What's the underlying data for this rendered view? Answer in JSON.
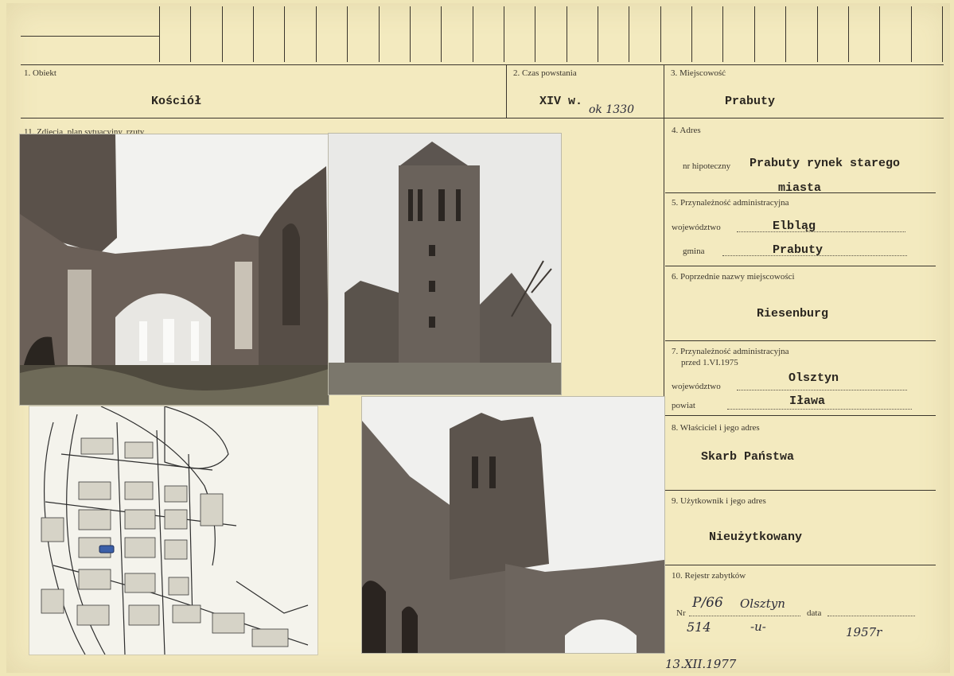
{
  "header": {
    "object_label": "1. Obiekt",
    "object_value": "Kościół",
    "time_label": "2. Czas powstania",
    "time_value": "XIV w.",
    "time_hand": "ok 1330",
    "place_label": "3. Miejscowość",
    "place_value": "Prabuty"
  },
  "photos_label": "11. Zdjęcia, plan sytuacyjny, rzuty",
  "fields": {
    "address_label": "4. Adres",
    "mortgage_label": "nr hipoteczny",
    "address_line1": "Prabuty rynek starego",
    "address_line2": "miasta",
    "admin_label": "5. Przynależność administracyjna",
    "voiv_label": "województwo",
    "voiv_value": "Elbląg",
    "gmina_label": "gmina",
    "gmina_value": "Prabuty",
    "prev_names_label": "6. Poprzednie nazwy miejscowości",
    "prev_names_value": "Riesenburg",
    "admin_before_label": "7. Przynależność administracyjna",
    "admin_before_sub": "przed 1.VI.1975",
    "voiv2_label": "województwo",
    "voiv2_value": "Olsztyn",
    "powiat_label": "powiat",
    "powiat_value": "Iława",
    "owner_label": "8. Właściciel i jego adres",
    "owner_value": "Skarb Państwa",
    "user_label": "9. Użytkownik i jego adres",
    "user_value": "Nieużytkowany",
    "register_label": "10. Rejestr zabytków",
    "nr_label": "Nr",
    "data_label": "data",
    "reg_hand1": "P/66",
    "reg_hand2": "Olsztyn",
    "reg_hand3": "514",
    "reg_hand4": "-u-",
    "reg_hand5": "1957r",
    "footer_date": "13.XII.1977"
  }
}
